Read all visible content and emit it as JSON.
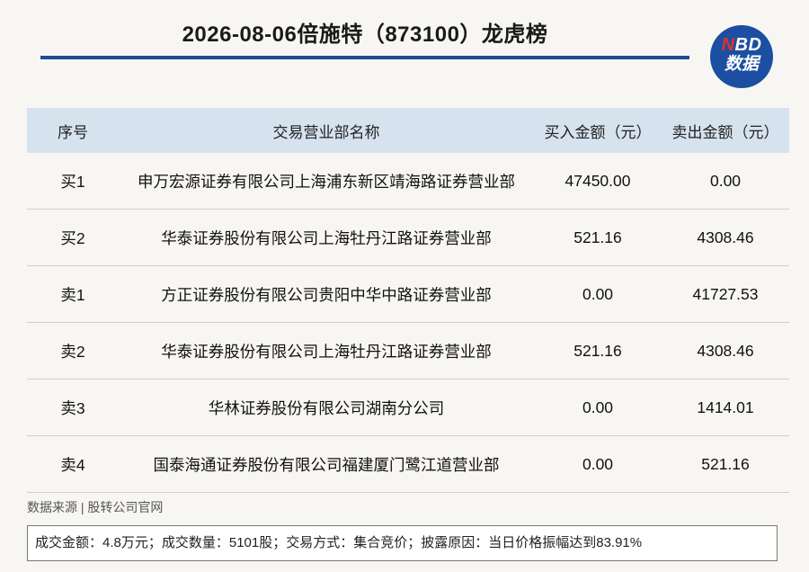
{
  "title": "2026-08-06倍施特（873100）龙虎榜",
  "logo": {
    "line1_n": "N",
    "line1_rest": "BD",
    "line2": "数据"
  },
  "table": {
    "headers": [
      "序号",
      "交易营业部名称",
      "买入金额（元）",
      "卖出金额（元）"
    ],
    "rows": [
      [
        "买1",
        "申万宏源证券有限公司上海浦东新区靖海路证券营业部",
        "47450.00",
        "0.00"
      ],
      [
        "买2",
        "华泰证券股份有限公司上海牡丹江路证券营业部",
        "521.16",
        "4308.46"
      ],
      [
        "卖1",
        "方正证券股份有限公司贵阳中华中路证券营业部",
        "0.00",
        "41727.53"
      ],
      [
        "卖2",
        "华泰证券股份有限公司上海牡丹江路证券营业部",
        "521.16",
        "4308.46"
      ],
      [
        "卖3",
        "华林证券股份有限公司湖南分公司",
        "0.00",
        "1414.01"
      ],
      [
        "卖4",
        "国泰海通证券股份有限公司福建厦门鹭江道营业部",
        "0.00",
        "521.16"
      ]
    ]
  },
  "source": "数据来源 | 股转公司官网",
  "summary": "成交金额：4.8万元；成交数量：5101股；交易方式：集合竞价；披露原因：当日价格振幅达到83.91%",
  "colors": {
    "accent": "#1e4b96",
    "header_bg": "#d6e2ee",
    "logo_red": "#e2322b"
  }
}
